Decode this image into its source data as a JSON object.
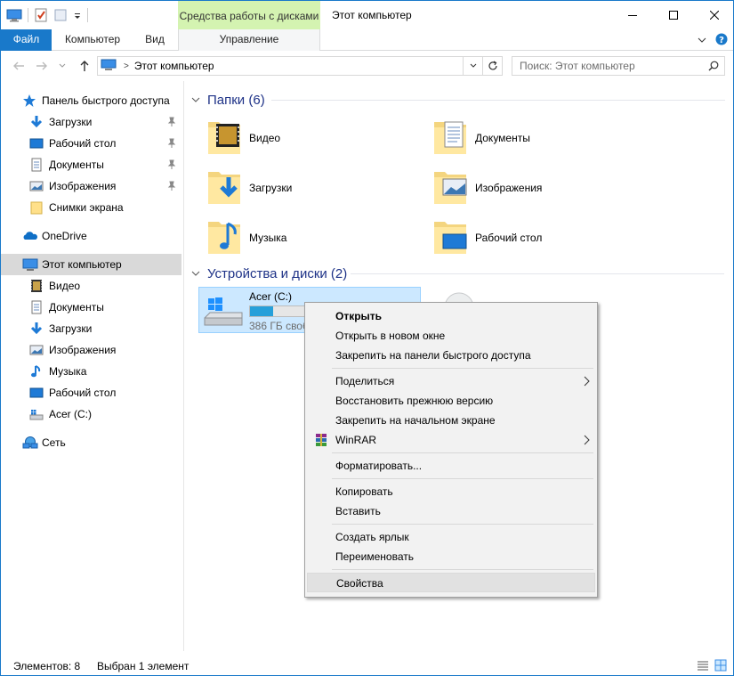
{
  "window": {
    "title": "Этот компьютер",
    "tools_context": "Средства работы с дисками"
  },
  "ribbon": {
    "tabs": [
      "Файл",
      "Компьютер",
      "Вид",
      "Управление"
    ]
  },
  "address": {
    "path": "Этот компьютер",
    "search_placeholder": "Поиск: Этот компьютер"
  },
  "sidebar": {
    "items": [
      {
        "label": "Панель быстрого доступа",
        "icon": "star-icon"
      },
      {
        "label": "Загрузки",
        "icon": "download-icon",
        "pinned": true
      },
      {
        "label": "Рабочий стол",
        "icon": "desktop-icon",
        "pinned": true
      },
      {
        "label": "Документы",
        "icon": "documents-icon",
        "pinned": true
      },
      {
        "label": "Изображения",
        "icon": "pictures-icon",
        "pinned": true
      },
      {
        "label": "Снимки экрана",
        "icon": "folder-icon"
      },
      {
        "label": "OneDrive",
        "icon": "onedrive-icon"
      },
      {
        "label": "Этот компьютер",
        "icon": "computer-icon",
        "selected": true
      },
      {
        "label": "Видео",
        "icon": "video-icon"
      },
      {
        "label": "Документы",
        "icon": "documents-icon"
      },
      {
        "label": "Загрузки",
        "icon": "download-icon"
      },
      {
        "label": "Изображения",
        "icon": "pictures-icon"
      },
      {
        "label": "Музыка",
        "icon": "music-icon"
      },
      {
        "label": "Рабочий стол",
        "icon": "desktop-icon"
      },
      {
        "label": "Acer (C:)",
        "icon": "drive-icon"
      },
      {
        "label": "Сеть",
        "icon": "network-icon"
      }
    ]
  },
  "main": {
    "folders_header": "Папки (6)",
    "folders": [
      {
        "label": "Видео",
        "icon": "video-folder-icon"
      },
      {
        "label": "Документы",
        "icon": "documents-folder-icon"
      },
      {
        "label": "Загрузки",
        "icon": "downloads-folder-icon"
      },
      {
        "label": "Изображения",
        "icon": "pictures-folder-icon"
      },
      {
        "label": "Музыка",
        "icon": "music-folder-icon"
      },
      {
        "label": "Рабочий стол",
        "icon": "desktop-folder-icon"
      }
    ],
    "devices_header": "Устройства и диски (2)",
    "drive": {
      "name": "Acer (C:)",
      "free_text": "386 ГБ своб",
      "used_fraction": 0.14
    }
  },
  "context_menu": {
    "items": [
      "Открыть",
      "Открыть в новом окне",
      "Закрепить на панели быстрого доступа",
      "Поделиться",
      "Восстановить прежнюю версию",
      "Закрепить на начальном экране",
      "WinRAR",
      "Форматировать...",
      "Копировать",
      "Вставить",
      "Создать ярлык",
      "Переименовать",
      "Свойства"
    ]
  },
  "status": {
    "items_count": "Элементов: 8",
    "selected": "Выбран 1 элемент"
  },
  "colors": {
    "accent": "#1979ca",
    "header_text": "#1e3287",
    "tools_tab": "#d4f3b1",
    "selection": "#cce8ff"
  }
}
